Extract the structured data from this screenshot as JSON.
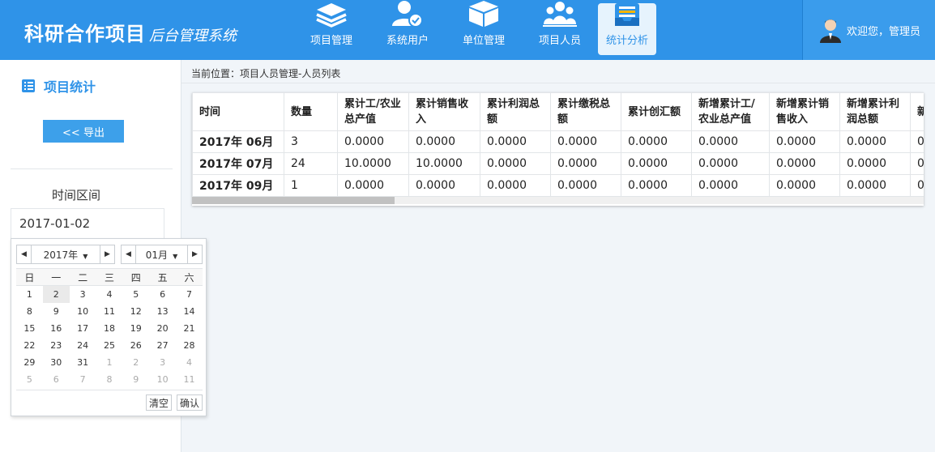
{
  "brand": {
    "main": "科研合作项目",
    "sub": "后台管理系统"
  },
  "nav": [
    {
      "label": "项目管理",
      "icon": "layers-icon"
    },
    {
      "label": "系统用户",
      "icon": "user-check-icon"
    },
    {
      "label": "单位管理",
      "icon": "box-icon"
    },
    {
      "label": "项目人员",
      "icon": "people-icon"
    },
    {
      "label": "统计分析",
      "icon": "inbox-tray-icon",
      "active": true
    }
  ],
  "header_right": {
    "welcome": "欢迎您，管理员"
  },
  "sidebar": {
    "title": "项目统计",
    "export_label": "<< 导出",
    "range_label": "时间区间",
    "date_value": "2017-01-02"
  },
  "calendar": {
    "year": "2017年",
    "month": "01月",
    "weekdays": [
      "日",
      "一",
      "二",
      "三",
      "四",
      "五",
      "六"
    ],
    "weeks": [
      [
        "1",
        "2",
        "3",
        "4",
        "5",
        "6",
        "7"
      ],
      [
        "8",
        "9",
        "10",
        "11",
        "12",
        "13",
        "14"
      ],
      [
        "15",
        "16",
        "17",
        "18",
        "19",
        "20",
        "21"
      ],
      [
        "22",
        "23",
        "24",
        "25",
        "26",
        "27",
        "28"
      ],
      [
        "29",
        "30",
        "31",
        "1",
        "2",
        "3",
        "4"
      ],
      [
        "5",
        "6",
        "7",
        "8",
        "9",
        "10",
        "11"
      ]
    ],
    "clear_label": "清空",
    "confirm_label": "确认"
  },
  "breadcrumb": "当前位置：项目人员管理-人员列表",
  "table": {
    "headers": [
      "时间",
      "数量",
      "累计工/农业总产值",
      "累计销售收入",
      "累计利润总额",
      "累计缴税总额",
      "累计创汇额",
      "新增累计工/农业总产值",
      "新增累计销售收入",
      "新增累计利润总额",
      "新增"
    ],
    "rows": [
      [
        "2017年 06月",
        "3",
        "0.0000",
        "0.0000",
        "0.0000",
        "0.0000",
        "0.0000",
        "0.0000",
        "0.0000",
        "0.0000",
        "0"
      ],
      [
        "2017年 07月",
        "24",
        "10.0000",
        "10.0000",
        "0.0000",
        "0.0000",
        "0.0000",
        "0.0000",
        "0.0000",
        "0.0000",
        "0"
      ],
      [
        "2017年 09月",
        "1",
        "0.0000",
        "0.0000",
        "0.0000",
        "0.0000",
        "0.0000",
        "0.0000",
        "0.0000",
        "0.0000",
        "0"
      ]
    ]
  },
  "colors": {
    "primary": "#2f93e8",
    "header_bg": "#2f93e8"
  }
}
